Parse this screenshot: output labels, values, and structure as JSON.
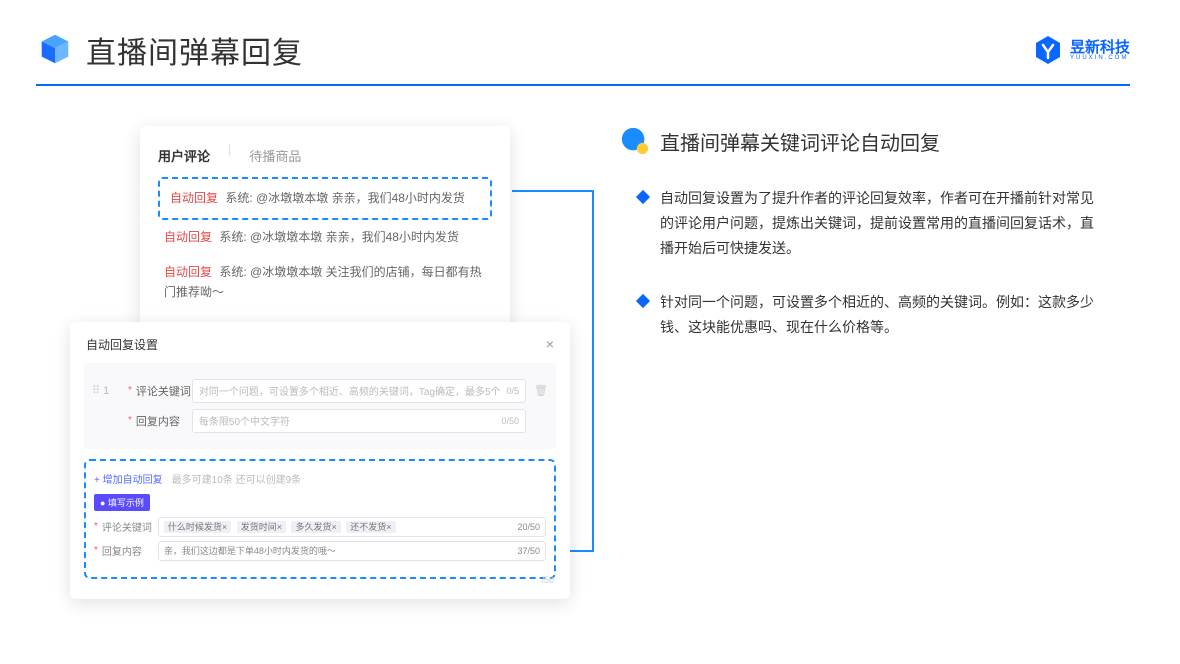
{
  "header": {
    "title": "直播间弹幕回复",
    "brand_name": "昱新科技",
    "brand_sub": "YUUXIN.COM"
  },
  "comments_card": {
    "tab_active": "用户评论",
    "tab_inactive": "待播商品",
    "rows": [
      {
        "tag": "自动回复",
        "prefix": "系统:",
        "text": "@冰墩墩本墩 亲亲，我们48小时内发货"
      },
      {
        "tag": "自动回复",
        "prefix": "系统:",
        "text": "@冰墩墩本墩 亲亲，我们48小时内发货"
      },
      {
        "tag": "自动回复",
        "prefix": "系统:",
        "text": "@冰墩墩本墩 关注我们的店铺，每日都有热门推荐呦～"
      }
    ]
  },
  "settings_card": {
    "title": "自动回复设置",
    "index": "1",
    "kw_label": "评论关键词",
    "kw_placeholder": "对同一个问题，可设置多个相近、高频的关键词，Tag确定，最多5个",
    "kw_count": "0/5",
    "content_label": "回复内容",
    "content_placeholder": "每条限50个中文字符",
    "content_count": "0/50",
    "add_link": "+ 增加自动回复",
    "add_hint": "最多可建10条 还可以创建9条",
    "example_badge": "● 填写示例",
    "ex_kw_label": "评论关键词",
    "ex_tags": [
      "什么时候发货×",
      "发货时间×",
      "多久发货×",
      "还不发货×"
    ],
    "ex_kw_count": "20/50",
    "ex_content_label": "回复内容",
    "ex_content_value": "亲，我们这边都是下单48小时内发货的哦～",
    "ex_content_count": "37/50",
    "faded": "/50"
  },
  "right": {
    "heading": "直播间弹幕关键词评论自动回复",
    "bullets": [
      "自动回复设置为了提升作者的评论回复效率，作者可在开播前针对常见的评论用户问题，提炼出关键词，提前设置常用的直播间回复话术，直播开始后可快捷发送。",
      "针对同一个问题，可设置多个相近的、高频的关键词。例如：这款多少钱、这块能优惠吗、现在什么价格等。"
    ]
  }
}
